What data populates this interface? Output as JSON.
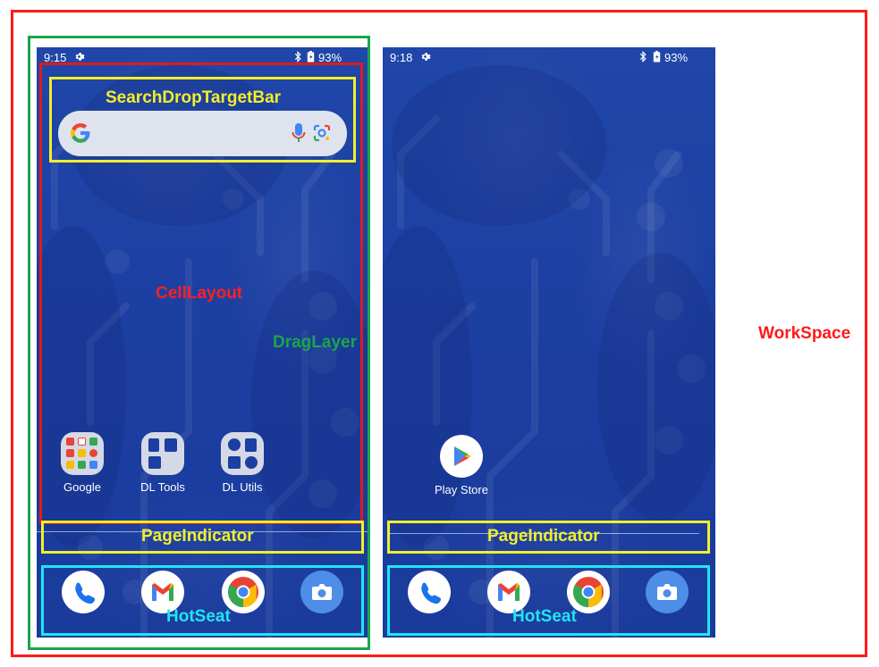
{
  "labels": {
    "search_drop_target_bar": "SearchDropTargetBar",
    "cell_layout": "CellLayout",
    "drag_layer": "DragLayer",
    "workspace": "WorkSpace",
    "page_indicator": "PageIndicator",
    "hotseat": "HotSeat"
  },
  "screen1": {
    "status": {
      "time": "9:15",
      "battery": "93%"
    },
    "apps": [
      {
        "label": "Google",
        "icon": "google-folder-icon"
      },
      {
        "label": "DL Tools",
        "icon": "dl-tools-folder-icon"
      },
      {
        "label": "DL Utils",
        "icon": "dl-utils-folder-icon"
      }
    ]
  },
  "screen2": {
    "status": {
      "time": "9:18",
      "battery": "93%"
    },
    "apps": [
      {
        "label": "Play Store",
        "icon": "play-store-icon"
      }
    ]
  },
  "hotseat_icons": [
    "phone-icon",
    "gmail-icon",
    "chrome-icon",
    "camera-icon"
  ],
  "colors": {
    "workspace_border": "#ff1a1a",
    "drag_layer_border": "#1aa64a",
    "search_bar_border": "#f2ef2a",
    "hotseat_border": "#21e5f0",
    "wallpaper": "#1c3fa2"
  }
}
